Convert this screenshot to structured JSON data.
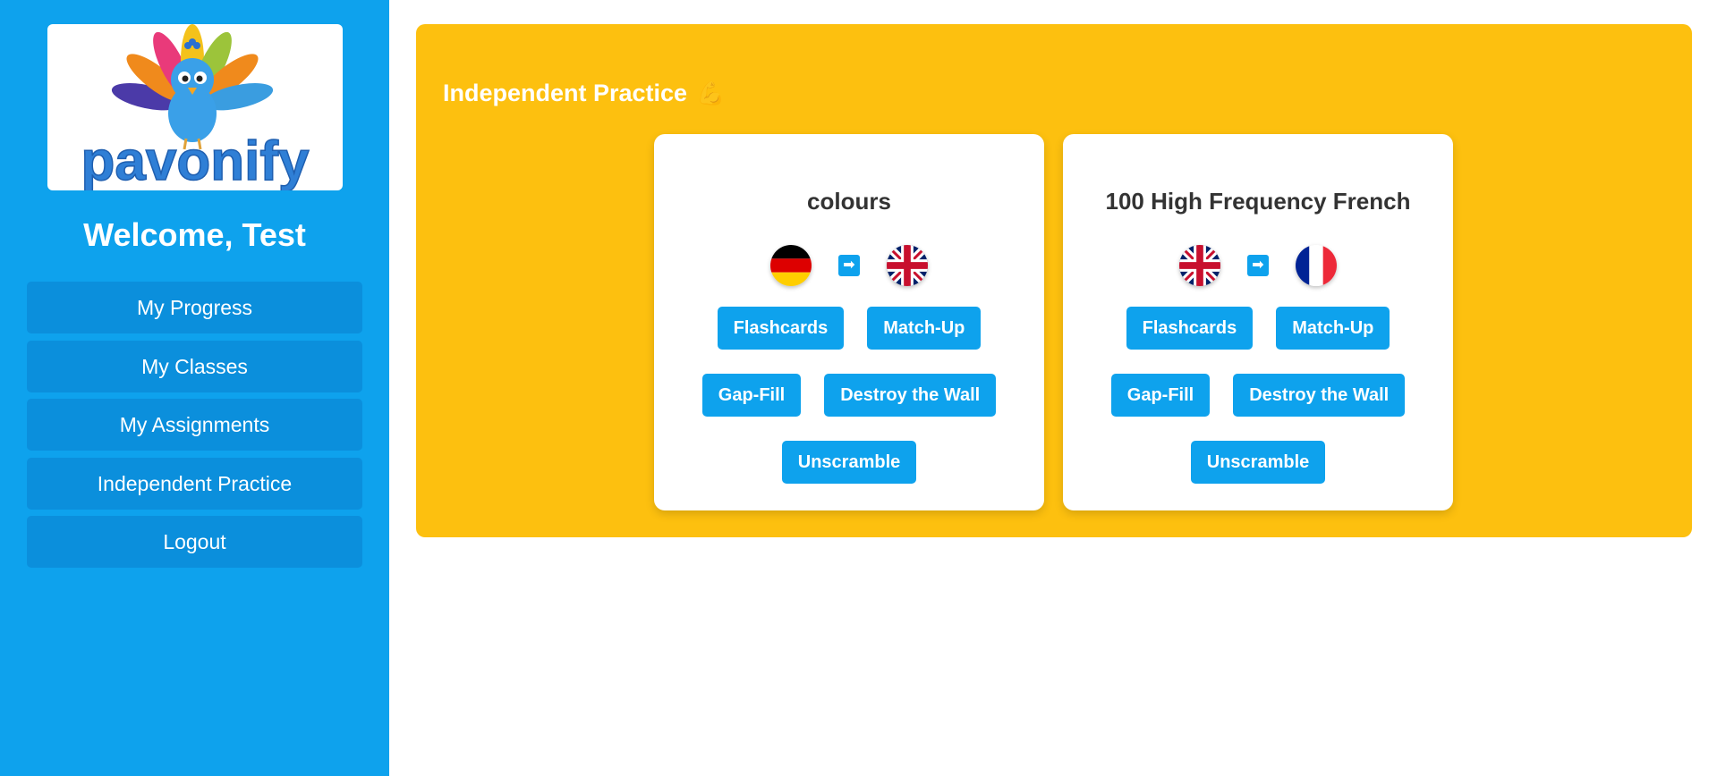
{
  "brand": {
    "name": "pavonify"
  },
  "sidebar": {
    "welcome": "Welcome, Test",
    "items": [
      {
        "label": "My Progress"
      },
      {
        "label": "My Classes"
      },
      {
        "label": "My Assignments"
      },
      {
        "label": "Independent Practice"
      },
      {
        "label": "Logout"
      }
    ]
  },
  "main": {
    "title": "Independent Practice",
    "title_emoji": "💪",
    "decks": [
      {
        "title": "colours",
        "from_flag": "germany-flag-icon",
        "to_flag": "uk-flag-icon",
        "arrow": "➡",
        "buttons": [
          "Flashcards",
          "Match-Up",
          "Gap-Fill",
          "Destroy the Wall",
          "Unscramble"
        ]
      },
      {
        "title": "100 High Frequency French",
        "from_flag": "uk-flag-icon",
        "to_flag": "france-flag-icon",
        "arrow": "➡",
        "buttons": [
          "Flashcards",
          "Match-Up",
          "Gap-Fill",
          "Destroy the Wall",
          "Unscramble"
        ]
      }
    ]
  },
  "colors": {
    "sidebar_bg": "#0ea2ed",
    "nav_item_bg": "#0b8fdc",
    "panel_bg": "#fdc00f",
    "button_bg": "#0ea2ed",
    "logo_text": "#2f7fd6"
  }
}
